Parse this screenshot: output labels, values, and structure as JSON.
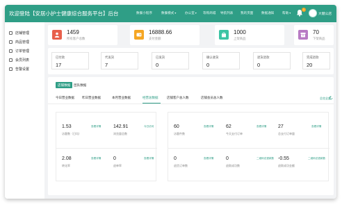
{
  "header": {
    "title": "欢迎登陆【安居小护士健康综合服务平台】后台",
    "nav": [
      {
        "label": "数餐小程序",
        "has_caret": false
      },
      {
        "label": "数餐模式",
        "has_caret": true
      },
      {
        "label": "办公室",
        "has_caret": true
      },
      {
        "label": "等购商城",
        "has_caret": false
      },
      {
        "label": "导航列表",
        "has_caret": false
      },
      {
        "label": "我的页面",
        "has_caret": false
      },
      {
        "label": "数据通知",
        "has_caret": false
      },
      {
        "label": "帮助",
        "has_caret": true
      }
    ],
    "notification_count": "1",
    "user_name": "大健公店"
  },
  "sidebar": {
    "items": [
      {
        "label": "店铺管理",
        "icon": "store-icon"
      },
      {
        "label": "商品管理",
        "icon": "goods-icon"
      },
      {
        "label": "订单管理",
        "icon": "order-icon"
      },
      {
        "label": "会员列表",
        "icon": "member-icon"
      },
      {
        "label": "告警设置",
        "icon": "settings-icon"
      }
    ]
  },
  "stats": [
    {
      "value": "1459",
      "label": "所有客户总数",
      "color": "#e8604c",
      "icon": "user-icon"
    },
    {
      "value": "16888.66",
      "label": "支付金额",
      "color": "#f5a623",
      "icon": "wallet-icon"
    },
    {
      "value": "1000",
      "label": "上架商品",
      "color": "#3dc4a4",
      "icon": "product-icon"
    },
    {
      "value": "70",
      "label": "下架商品",
      "color": "#b87bc4",
      "icon": "archive-icon"
    }
  ],
  "orders": [
    {
      "label": "已付款",
      "value": "17"
    },
    {
      "label": "代发货",
      "value": "7"
    },
    {
      "label": "已发货",
      "value": "0"
    },
    {
      "label": "确认收货",
      "value": "0"
    },
    {
      "label": "退货退款",
      "value": "0"
    },
    {
      "label": "完成退款",
      "value": "20"
    }
  ],
  "panel": {
    "segments": [
      {
        "label": "店铺数据",
        "active": true
      },
      {
        "label": "团队数据",
        "active": false
      }
    ],
    "tabs": [
      {
        "label": "今日营业数据",
        "active": false
      },
      {
        "label": "昨日营业数据",
        "active": false
      },
      {
        "label": "本月营业数据",
        "active": false
      },
      {
        "label": "经营总数据",
        "active": true
      },
      {
        "label": "店铺客户总人数",
        "active": false
      },
      {
        "label": "店铺会员总人数",
        "active": false
      }
    ],
    "tab_action": "总览全部",
    "metrics": [
      {
        "value": "1.53",
        "label": "访客数（日均）",
        "link": "查看详情"
      },
      {
        "value": "142.91",
        "label": "浏览量总数",
        "link": "今日访问"
      },
      {
        "value": "60",
        "label": "访客件数",
        "link": "查看详情"
      },
      {
        "value": "62",
        "label": "今天支付订单",
        "link": "查看详情"
      },
      {
        "value": "27",
        "label": "总支付订单量",
        "link": "查看详情"
      },
      {
        "value": "2.08",
        "label": "转化率",
        "link": "查看详情"
      },
      {
        "value": "0",
        "label": "退单率",
        "link": "查看详情"
      },
      {
        "value": "0",
        "label": "退货订单数",
        "link": "查看详情"
      },
      {
        "value": "0",
        "label": "退款成功数",
        "link": "二维码总退款数"
      },
      {
        "value": "-0.55",
        "label": "退款成功金额",
        "link": "二维码总退款数"
      }
    ]
  }
}
